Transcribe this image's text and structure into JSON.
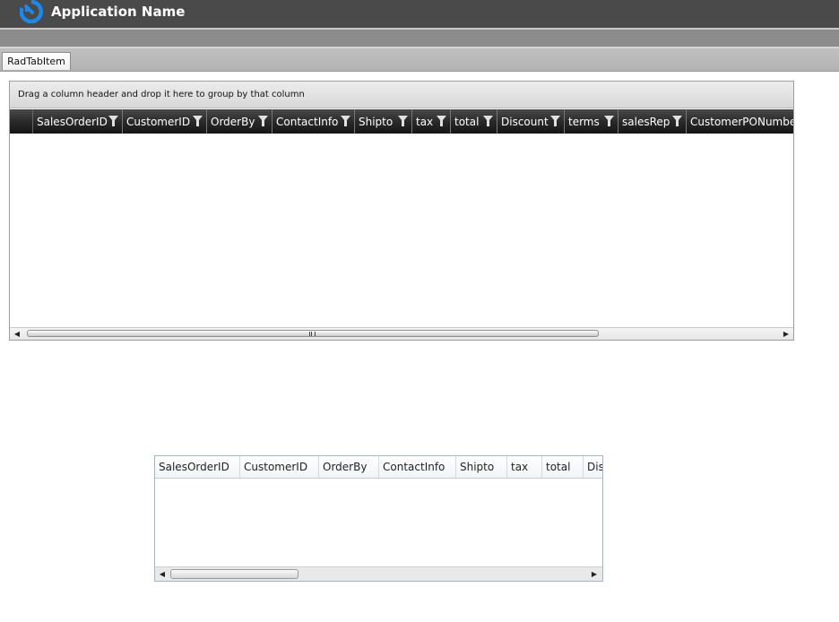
{
  "app": {
    "title": "Application Name",
    "logo_icon": "circular-arrow-logo-icon",
    "logo_color": "#1e88e5"
  },
  "tabs": [
    {
      "label": "RadTabItem",
      "selected": true
    }
  ],
  "grid1": {
    "group_panel_text": "Drag a column header and drop it here to group by that column",
    "columns": [
      "SalesOrderID",
      "CustomerID",
      "OrderBy",
      "ContactInfo",
      "Shipto",
      "tax",
      "total",
      "Discount",
      "terms",
      "salesRep",
      "CustomerPONumber"
    ],
    "filter_icon": "funnel-filter-icon",
    "rows": [],
    "scroll_left_icon": "triangle-left-icon",
    "scroll_right_icon": "triangle-right-icon"
  },
  "grid2": {
    "columns": [
      "SalesOrderID",
      "CustomerID",
      "OrderBy",
      "ContactInfo",
      "Shipto",
      "tax",
      "total",
      "Dis"
    ],
    "rows": [],
    "scroll_left_icon": "triangle-left-icon",
    "scroll_right_icon": "triangle-right-icon"
  },
  "colors": {
    "titlebar": "#4a4a4a",
    "header_dark": "#1f1f1f",
    "header_light": "#f1f3f6"
  }
}
